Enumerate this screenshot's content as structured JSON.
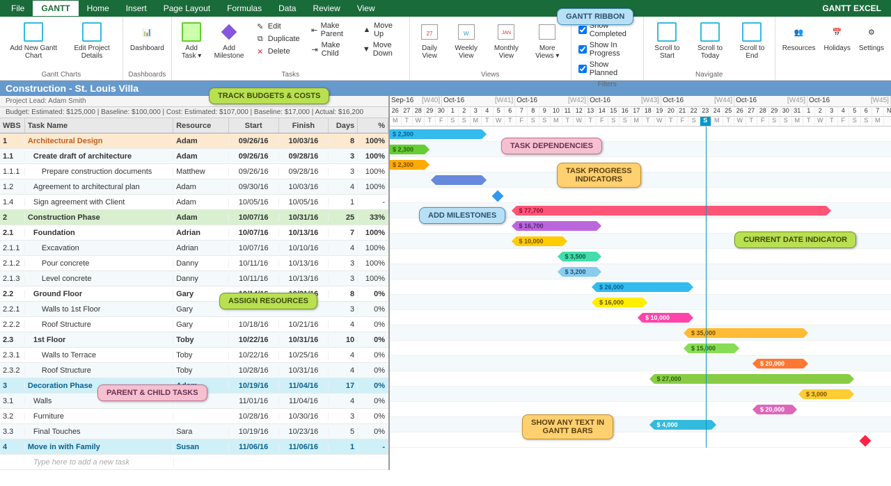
{
  "brand": "GANTT EXCEL",
  "menu": [
    "File",
    "GANTT",
    "Home",
    "Insert",
    "Page Layout",
    "Formulas",
    "Data",
    "Review",
    "View"
  ],
  "ribbon": {
    "groups": {
      "ganttCharts": {
        "label": "Gantt Charts",
        "btns": [
          {
            "label": "Add New\nGantt Chart"
          },
          {
            "label": "Edit Project\nDetails"
          }
        ]
      },
      "dashboards": {
        "label": "Dashboards",
        "btns": [
          {
            "label": "Dashboard"
          }
        ]
      },
      "tasksBig": {
        "btns": [
          {
            "label": "Add\nTask ▾"
          },
          {
            "label": "Add\nMilestone"
          }
        ]
      },
      "tasksSmall": [
        [
          "Edit",
          "Duplicate",
          "Delete"
        ],
        [
          "Make Parent",
          "Make Child"
        ],
        [
          "Move Up",
          "Move Down"
        ]
      ],
      "tasksLabel": "Tasks",
      "views": {
        "label": "Views",
        "btns": [
          {
            "label": "Daily\nView"
          },
          {
            "label": "Weekly\nView"
          },
          {
            "label": "Monthly\nView"
          },
          {
            "label": "More\nViews ▾"
          }
        ]
      },
      "filters": {
        "label": "Filters",
        "chks": [
          {
            "label": "Show Completed",
            "c": true
          },
          {
            "label": "Show In Progress",
            "c": true
          },
          {
            "label": "Show Planned",
            "c": true
          }
        ]
      },
      "navigate": {
        "label": "Navigate",
        "btns": [
          {
            "label": "Scroll\nto Start"
          },
          {
            "label": "Scroll to\nToday"
          },
          {
            "label": "Scroll\nto End"
          }
        ]
      },
      "res": {
        "label": "",
        "btns": [
          {
            "label": "Resources"
          },
          {
            "label": "Holidays"
          },
          {
            "label": "Settings"
          }
        ]
      }
    }
  },
  "project": {
    "title": "Construction - St. Louis Villa",
    "lead": "Project Lead: Adam Smith",
    "budget": "Budget: Estimated: $125,000 | Baseline: $100,000 | Cost: Estimated: $107,000 | Baseline: $17,000 | Actual: $16,200"
  },
  "cols": {
    "wbs": "WBS",
    "task": "Task Name",
    "res": "Resource",
    "start": "Start",
    "finish": "Finish",
    "days": "Days",
    "pct": "%"
  },
  "months": [
    {
      "name": "Sep-16",
      "wk": "[W40]",
      "days": 5
    },
    {
      "name": "Oct-16",
      "wk": "[W41]",
      "days": 7
    },
    {
      "name": "Oct-16",
      "wk": "[W42]",
      "days": 7
    },
    {
      "name": "Oct-16",
      "wk": "[W43]",
      "days": 7
    },
    {
      "name": "Oct-16",
      "wk": "[W44]",
      "days": 7
    },
    {
      "name": "Oct-16",
      "wk": "[W45]",
      "days": 7
    },
    {
      "name": "Oct-16",
      "wk": "[W45]",
      "days": 8
    }
  ],
  "daynums": [
    "26",
    "27",
    "28",
    "29",
    "30",
    "1",
    "2",
    "3",
    "4",
    "5",
    "6",
    "7",
    "8",
    "9",
    "10",
    "11",
    "12",
    "13",
    "14",
    "15",
    "16",
    "17",
    "18",
    "19",
    "20",
    "21",
    "22",
    "23",
    "24",
    "25",
    "26",
    "27",
    "28",
    "29",
    "30",
    "31",
    "1",
    "2",
    "3",
    "4",
    "5",
    "6",
    "7",
    "N"
  ],
  "dow": [
    "M",
    "T",
    "W",
    "T",
    "F",
    "S",
    "S",
    "M",
    "T",
    "W",
    "T",
    "F",
    "S",
    "S",
    "M",
    "T",
    "W",
    "T",
    "F",
    "S",
    "S",
    "M",
    "T",
    "W",
    "T",
    "F",
    "S",
    "S",
    "M",
    "T",
    "W",
    "T",
    "F",
    "S",
    "S",
    "M",
    "T",
    "W",
    "T",
    "F",
    "S",
    "S",
    "M",
    ""
  ],
  "todayIdx": 27,
  "rows": [
    {
      "wbs": "1",
      "task": "Architectural Design",
      "res": "Adam",
      "start": "09/26/16",
      "finish": "10/03/16",
      "days": "8",
      "pct": "100%",
      "type": "summary",
      "bar": {
        "l": 0,
        "w": 8,
        "color": "#33bbee",
        "text": "$ 2,300",
        "tc": "#0a6090"
      }
    },
    {
      "wbs": "1.1",
      "task": "Create draft of architecture",
      "res": "Adam",
      "start": "09/26/16",
      "finish": "09/28/16",
      "days": "3",
      "pct": "100%",
      "type": "bold",
      "indent": 1,
      "bar": {
        "l": 0,
        "w": 3,
        "color": "#66cc33",
        "text": "$ 2,300",
        "tc": "#2a6010"
      }
    },
    {
      "wbs": "1.1.1",
      "task": "Prepare construction documents",
      "res": "Matthew",
      "start": "09/26/16",
      "finish": "09/28/16",
      "days": "3",
      "pct": "100%",
      "indent": 2,
      "bar": {
        "l": 0,
        "w": 3,
        "color": "#ffaa00",
        "text": "$ 2,300",
        "tc": "#7a5000"
      }
    },
    {
      "wbs": "1.2",
      "task": "Agreement to architectural plan",
      "res": "Adam",
      "start": "09/30/16",
      "finish": "10/03/16",
      "days": "4",
      "pct": "100%",
      "indent": 1,
      "bar": {
        "l": 4,
        "w": 4,
        "color": "#6688dd"
      }
    },
    {
      "wbs": "1.4",
      "task": "Sign agreement with Client",
      "res": "Adam",
      "start": "10/05/16",
      "finish": "10/05/16",
      "days": "1",
      "pct": "-",
      "indent": 1,
      "milestone": {
        "l": 9,
        "color": "#3399ee"
      }
    },
    {
      "wbs": "2",
      "task": "Construction Phase",
      "res": "Adam",
      "start": "10/07/16",
      "finish": "10/31/16",
      "days": "25",
      "pct": "33%",
      "type": "summary2",
      "bar": {
        "l": 11,
        "w": 27,
        "color": "#ff5577",
        "text": "$ 77,700",
        "tc": "#8a1030",
        "prog": 0.33
      }
    },
    {
      "wbs": "2.1",
      "task": "Foundation",
      "res": "Adrian",
      "start": "10/07/16",
      "finish": "10/13/16",
      "days": "7",
      "pct": "100%",
      "type": "bold",
      "indent": 1,
      "bar": {
        "l": 11,
        "w": 7,
        "color": "#bb66dd",
        "text": "$ 16,700",
        "tc": "#5a2070"
      }
    },
    {
      "wbs": "2.1.1",
      "task": "Excavation",
      "res": "Adrian",
      "start": "10/07/16",
      "finish": "10/10/16",
      "days": "4",
      "pct": "100%",
      "indent": 2,
      "bar": {
        "l": 11,
        "w": 4,
        "color": "#ffcc00",
        "text": "$ 10,000",
        "tc": "#7a5000"
      }
    },
    {
      "wbs": "2.1.2",
      "task": "Pour concrete",
      "res": "Danny",
      "start": "10/11/16",
      "finish": "10/13/16",
      "days": "3",
      "pct": "100%",
      "indent": 2,
      "bar": {
        "l": 15,
        "w": 3,
        "color": "#44ddaa",
        "text": "$ 3,500",
        "tc": "#0a6040"
      }
    },
    {
      "wbs": "2.1.3",
      "task": "Level concrete",
      "res": "Danny",
      "start": "10/11/16",
      "finish": "10/13/16",
      "days": "3",
      "pct": "100%",
      "indent": 2,
      "bar": {
        "l": 15,
        "w": 3,
        "color": "#88ccee",
        "text": "$ 3,200",
        "tc": "#2a5070"
      }
    },
    {
      "wbs": "2.2",
      "task": "Ground Floor",
      "res": "Gary",
      "start": "10/14/16",
      "finish": "10/21/16",
      "days": "8",
      "pct": "0%",
      "type": "bold",
      "indent": 1,
      "bar": {
        "l": 18,
        "w": 8,
        "color": "#33bbee",
        "text": "$ 26,000",
        "tc": "#0a6090"
      }
    },
    {
      "wbs": "2.2.1",
      "task": "Walls to 1st Floor",
      "res": "Gary",
      "start": "",
      "finish": "",
      "days": "3",
      "pct": "0%",
      "indent": 2,
      "bar": {
        "l": 18,
        "w": 4,
        "color": "#ffee00",
        "text": "$ 16,000",
        "tc": "#6a5000"
      }
    },
    {
      "wbs": "2.2.2",
      "task": "Roof Structure",
      "res": "Gary",
      "start": "10/18/16",
      "finish": "10/21/16",
      "days": "4",
      "pct": "0%",
      "indent": 2,
      "bar": {
        "l": 22,
        "w": 4,
        "color": "#ff44aa",
        "text": "$ 10,000",
        "tc": "#fff"
      }
    },
    {
      "wbs": "2.3",
      "task": "1st Floor",
      "res": "Toby",
      "start": "10/22/16",
      "finish": "10/31/16",
      "days": "10",
      "pct": "0%",
      "type": "bold",
      "indent": 1,
      "bar": {
        "l": 26,
        "w": 10,
        "color": "#ffbb33",
        "text": "$ 35,000",
        "tc": "#7a5000"
      }
    },
    {
      "wbs": "2.3.1",
      "task": "Walls to Terrace",
      "res": "Toby",
      "start": "10/22/16",
      "finish": "10/25/16",
      "days": "4",
      "pct": "0%",
      "indent": 2,
      "bar": {
        "l": 26,
        "w": 4,
        "color": "#88dd55",
        "text": "$ 15,000",
        "tc": "#2a6010"
      }
    },
    {
      "wbs": "2.3.2",
      "task": "Roof Structure",
      "res": "Toby",
      "start": "10/28/16",
      "finish": "10/31/16",
      "days": "4",
      "pct": "0%",
      "indent": 2,
      "bar": {
        "l": 32,
        "w": 4,
        "color": "#ff7733",
        "text": "$ 20,000",
        "tc": "#fff"
      }
    },
    {
      "wbs": "3",
      "task": "Decoration Phase",
      "res": "Adam",
      "start": "10/19/16",
      "finish": "11/04/16",
      "days": "17",
      "pct": "0%",
      "type": "summary3",
      "bar": {
        "l": 23,
        "w": 17,
        "color": "#88cc44",
        "text": "$ 27,000",
        "tc": "#2a6010"
      }
    },
    {
      "wbs": "3.1",
      "task": "Walls",
      "res": "",
      "start": "11/01/16",
      "finish": "11/04/16",
      "days": "4",
      "pct": "0%",
      "indent": 1,
      "bar": {
        "l": 36,
        "w": 4,
        "color": "#ffcc33",
        "text": "$ 3,000",
        "tc": "#7a5000"
      }
    },
    {
      "wbs": "3.2",
      "task": "Furniture",
      "res": "",
      "start": "10/28/16",
      "finish": "10/30/16",
      "days": "3",
      "pct": "0%",
      "indent": 1,
      "bar": {
        "l": 32,
        "w": 3,
        "color": "#dd66bb",
        "text": "$ 20,000",
        "tc": "#fff"
      }
    },
    {
      "wbs": "3.3",
      "task": "Final Touches",
      "res": "Sara",
      "start": "10/19/16",
      "finish": "10/23/16",
      "days": "5",
      "pct": "0%",
      "indent": 1,
      "bar": {
        "l": 23,
        "w": 5,
        "color": "#33bbdd",
        "text": "$ 4,000",
        "tc": "#fff"
      }
    },
    {
      "wbs": "4",
      "task": "Move in with Family",
      "res": "Susan",
      "start": "11/06/16",
      "finish": "11/06/16",
      "days": "1",
      "pct": "-",
      "type": "summary4",
      "milestone": {
        "l": 41,
        "color": "#ff2244"
      }
    }
  ],
  "newtask": "Type here to add a new task",
  "callouts": {
    "ganttRibbon": "GANTT RIBBON",
    "trackBudgets": "TRACK BUDGETS & COSTS",
    "taskDeps": "TASK DEPENDENCIES",
    "taskProg": "TASK PROGRESS\nINDICATORS",
    "addMile": "ADD MILESTONES",
    "currentDate": "CURRENT DATE INDICATOR",
    "assignRes": "ASSIGN RESOURCES",
    "parentChild": "PARENT & CHILD TASKS",
    "showText": "SHOW ANY TEXT IN\nGANTT BARS"
  }
}
